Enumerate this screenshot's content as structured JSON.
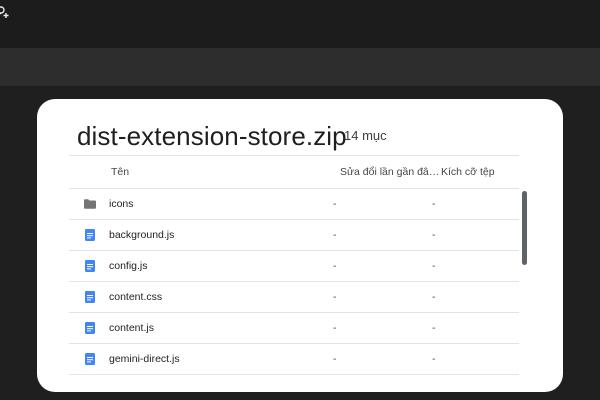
{
  "dialog": {
    "title": "dist-extension-store.zip",
    "item_count": "14 mục",
    "columns": {
      "name": "Tên",
      "modified": "Sửa đổi lần gần đây nhất",
      "size": "Kích cỡ tệp"
    },
    "rows": [
      {
        "name": "icons",
        "type": "folder",
        "modified": "-",
        "size": "-"
      },
      {
        "name": "background.js",
        "type": "file",
        "modified": "-",
        "size": "-"
      },
      {
        "name": "config.js",
        "type": "file",
        "modified": "-",
        "size": "-"
      },
      {
        "name": "content.css",
        "type": "file",
        "modified": "-",
        "size": "-"
      },
      {
        "name": "content.js",
        "type": "file",
        "modified": "-",
        "size": "-"
      },
      {
        "name": "gemini-direct.js",
        "type": "file",
        "modified": "-",
        "size": "-"
      }
    ]
  },
  "colors": {
    "file_icon": "#4285f4",
    "folder_icon": "#757575"
  }
}
